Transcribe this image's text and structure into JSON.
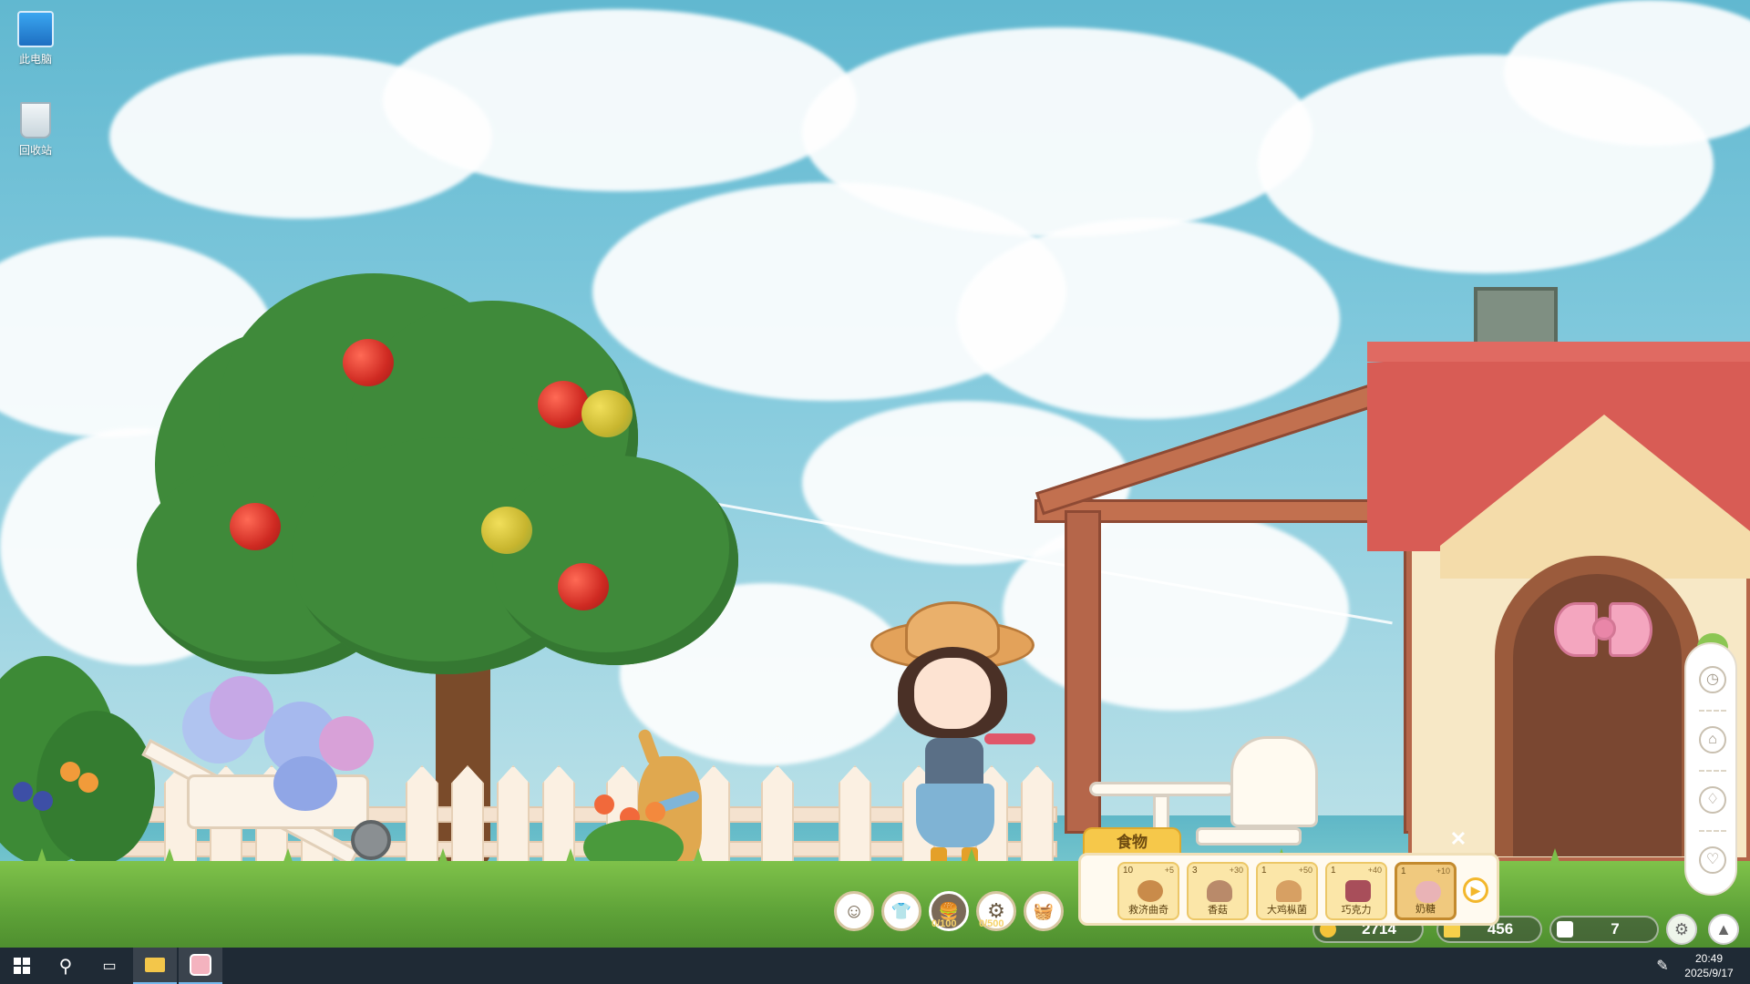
{
  "desktop": {
    "icons": [
      {
        "label": "此电脑",
        "icon": "computer-icon"
      },
      {
        "label": "回收站",
        "icon": "recycle-bin-icon"
      }
    ]
  },
  "hud": {
    "buttons": [
      {
        "name": "emote-button",
        "icon": "smile-icon",
        "glyph": "☺"
      },
      {
        "name": "outfit-button",
        "icon": "shirt-icon",
        "glyph": "👕"
      },
      {
        "name": "food-button",
        "icon": "burger-icon",
        "glyph": "🍔",
        "sub": "0/100"
      },
      {
        "name": "gear-progress-button",
        "icon": "cog-icon",
        "glyph": "⚙",
        "sub": "0/500"
      },
      {
        "name": "basket-button",
        "icon": "basket-icon",
        "glyph": "🧺"
      }
    ]
  },
  "food_panel": {
    "tab_label": "食物",
    "close_glyph": "✕",
    "next_glyph": "▶",
    "items": [
      {
        "count": "10",
        "bonus": "+5",
        "label": "救济曲奇",
        "color": "#c98b4a"
      },
      {
        "count": "3",
        "bonus": "+30",
        "label": "香菇",
        "color": "#b98a6a"
      },
      {
        "count": "1",
        "bonus": "+50",
        "label": "大鸡枞菌",
        "color": "#d7a063"
      },
      {
        "count": "1",
        "bonus": "+40",
        "label": "巧克力",
        "color": "#a84e5a"
      },
      {
        "count": "1",
        "bonus": "+10",
        "label": "奶糖",
        "color": "#e9b3b6",
        "selected": true
      }
    ]
  },
  "stats": {
    "coins": "2714",
    "stars": "456",
    "houses": "7"
  },
  "side_panel": {
    "buttons": [
      "clock-icon",
      "tent-icon",
      "bag-icon",
      "heart-icon"
    ]
  },
  "taskbar": {
    "time": "20:49",
    "date": "2025/9/17"
  },
  "colors": {
    "sky": "#61b8d0",
    "grass": "#5ea238",
    "roof": "#d85c55",
    "accent": "#f6c84a"
  }
}
